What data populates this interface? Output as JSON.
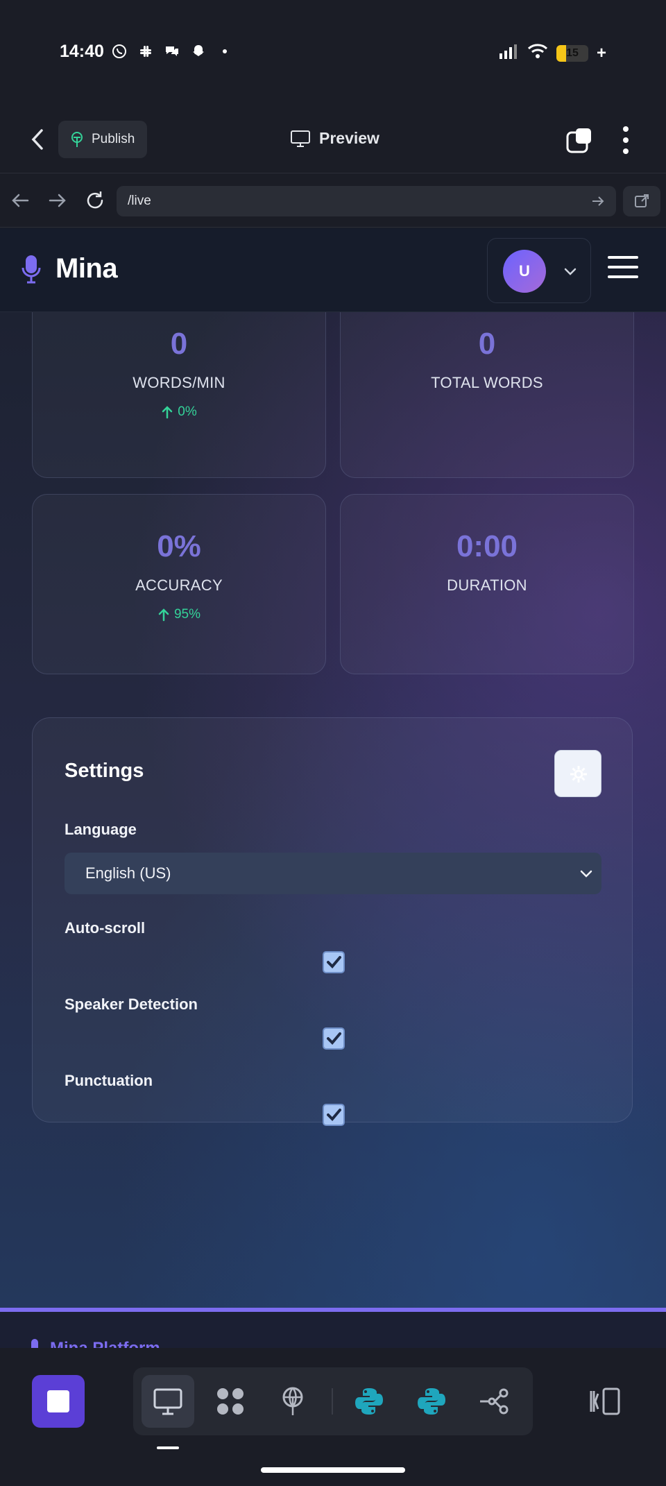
{
  "status_bar": {
    "time": "14:40",
    "app_icons": [
      "whatsapp-icon",
      "slack-icon",
      "chat-icon",
      "snapchat-icon"
    ],
    "battery_level": "15"
  },
  "app_bar": {
    "publish_label": "Publish",
    "preview_label": "Preview"
  },
  "browser": {
    "url": "/live"
  },
  "site": {
    "brand": "Mina",
    "avatar_initial": "U"
  },
  "stats": [
    {
      "value": "0",
      "label": "WORDS/MIN",
      "trend": "0%"
    },
    {
      "value": "0",
      "label": "TOTAL WORDS",
      "trend": ""
    },
    {
      "value": "0%",
      "label": "ACCURACY",
      "trend": "95%"
    },
    {
      "value": "0:00",
      "label": "DURATION",
      "trend": ""
    }
  ],
  "settings": {
    "title": "Settings",
    "language_label": "Language",
    "language_value": "English (US)",
    "auto_scroll_label": "Auto-scroll",
    "auto_scroll_checked": true,
    "speaker_detection_label": "Speaker Detection",
    "speaker_detection_checked": true,
    "punctuation_label": "Punctuation",
    "punctuation_checked": true
  },
  "footer": {
    "brand_peek": "Mina Platform"
  },
  "colors": {
    "accent": "#7c6cf0",
    "stat_value": "#7a73d8",
    "trend_up": "#34d399",
    "stop_button": "#5b3fd6"
  }
}
